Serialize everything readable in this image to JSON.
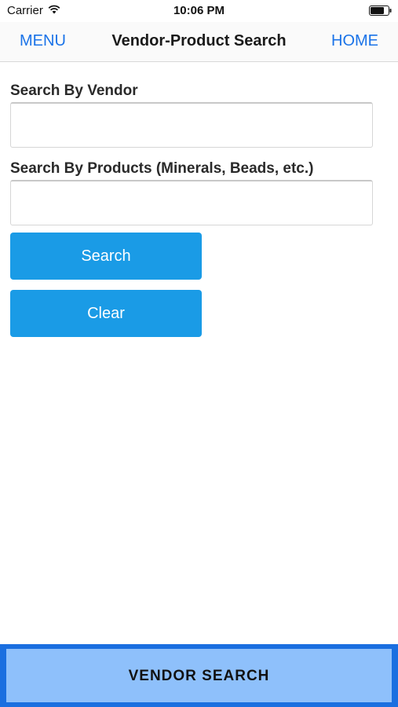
{
  "status_bar": {
    "carrier": "Carrier",
    "time": "10:06 PM",
    "icons": [
      "wifi-icon",
      "battery-icon"
    ]
  },
  "nav": {
    "left_label": "MENU",
    "title": "Vendor-Product Search",
    "right_label": "HOME",
    "accent_color": "#1a73e8"
  },
  "form": {
    "vendor_label": "Search By Vendor",
    "vendor_value": "",
    "products_label": "Search By Products (Minerals, Beads, etc.)",
    "products_value": ""
  },
  "buttons": {
    "search_label": "Search",
    "clear_label": "Clear",
    "color": "#1a9be6"
  },
  "bottom_tab": {
    "label": "VENDOR SEARCH",
    "fill_color": "#8ec0fb",
    "border_color": "#1a6fe0"
  }
}
